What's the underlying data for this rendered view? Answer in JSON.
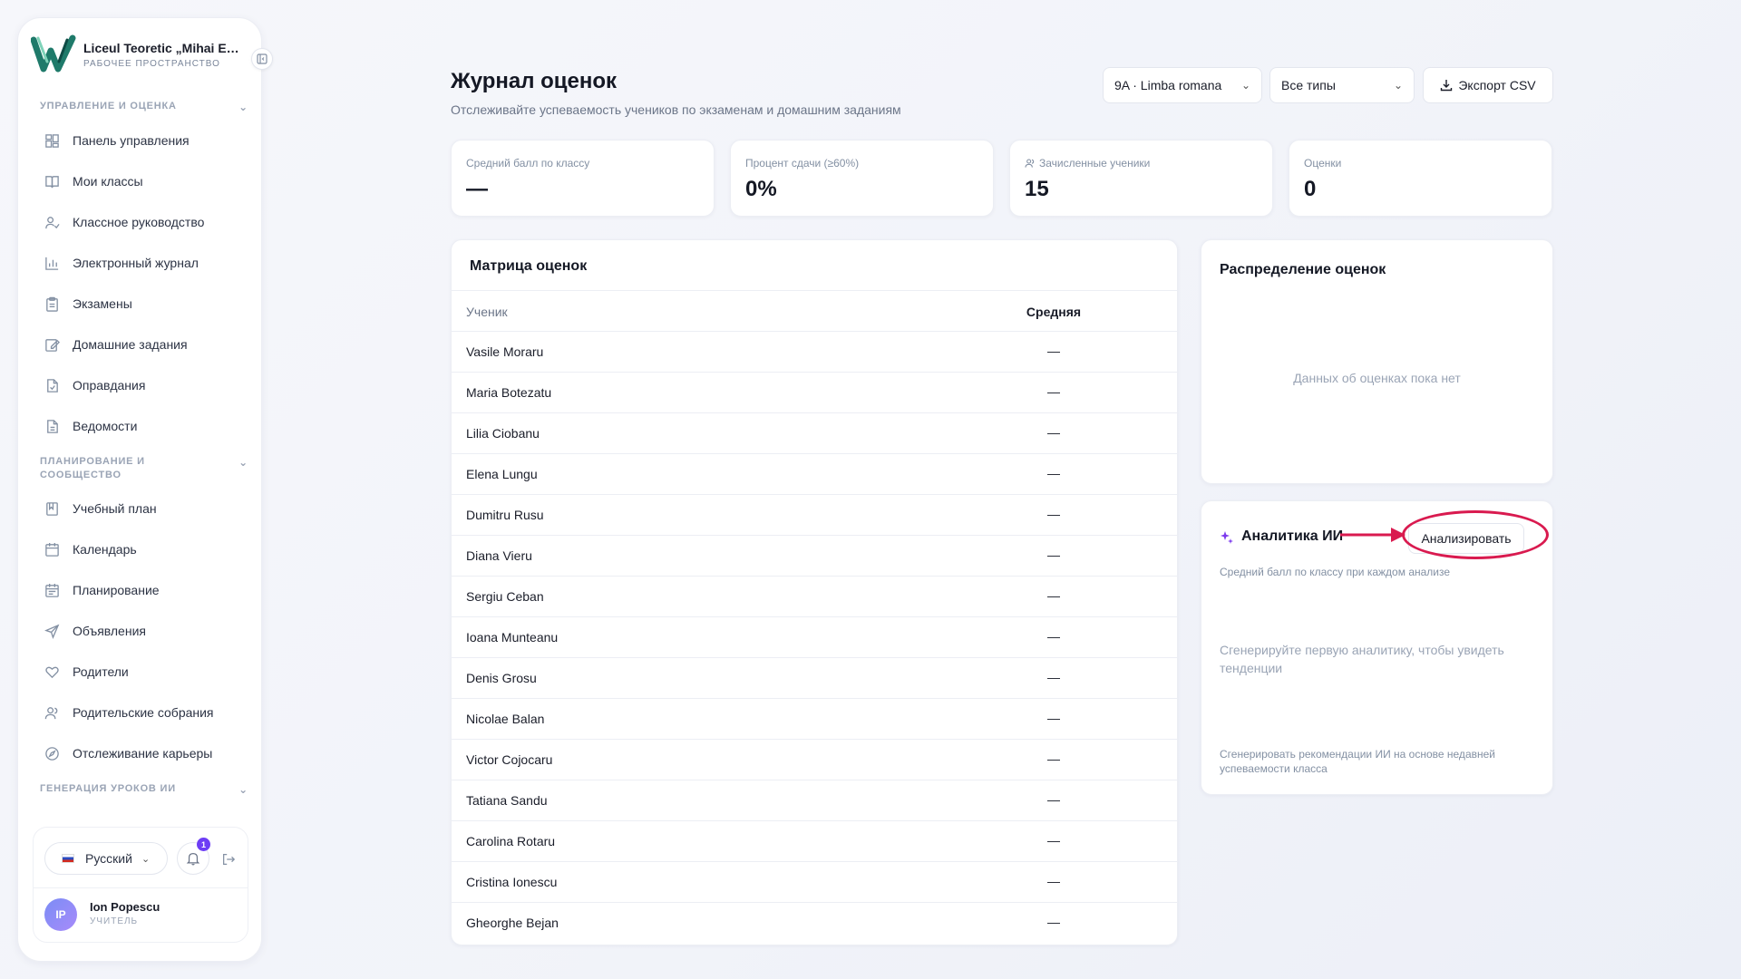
{
  "sidebar": {
    "brand_name": "Liceul Teoretic „Mihai Eminescu”",
    "brand_sub": "РАБОЧЕЕ ПРОСТРАНСТВО",
    "sections": {
      "manage": "УПРАВЛЕНИЕ И ОЦЕНКА",
      "plan": "ПЛАНИРОВАНИЕ И СООБЩЕСТВО",
      "ai": "ГЕНЕРАЦИЯ УРОКОВ ИИ"
    },
    "items": [
      {
        "label": "Панель управления",
        "icon": "dashboard-icon"
      },
      {
        "label": "Мои классы",
        "icon": "book-icon"
      },
      {
        "label": "Классное руководство",
        "icon": "user-check-icon"
      },
      {
        "label": "Электронный журнал",
        "icon": "bar-chart-icon"
      },
      {
        "label": "Экзамены",
        "icon": "clipboard-icon"
      },
      {
        "label": "Домашние задания",
        "icon": "edit-icon"
      },
      {
        "label": "Оправдания",
        "icon": "file-check-icon"
      },
      {
        "label": "Ведомости",
        "icon": "file-text-icon"
      },
      {
        "label": "Учебный план",
        "icon": "notebook-icon"
      },
      {
        "label": "Календарь",
        "icon": "calendar-icon"
      },
      {
        "label": "Планирование",
        "icon": "calendar-check-icon"
      },
      {
        "label": "Объявления",
        "icon": "send-icon"
      },
      {
        "label": "Родители",
        "icon": "heart-icon"
      },
      {
        "label": "Родительские собрания",
        "icon": "users-icon"
      },
      {
        "label": "Отслеживание карьеры",
        "icon": "compass-icon"
      }
    ],
    "footer": {
      "language": "Русский",
      "notifications_count": "1",
      "avatar_initials": "IP",
      "user_name": "Ion Popescu",
      "user_role": "УЧИТЕЛЬ"
    }
  },
  "header": {
    "title": "Журнал оценок",
    "subtitle": "Отслеживайте успеваемость учеников по экзаменам и домашним заданиям",
    "class_select": "9A · Limba romana",
    "type_select": "Все типы",
    "export_label": "Экспорт CSV"
  },
  "stats": [
    {
      "label": "Средний балл по классу",
      "value": "—"
    },
    {
      "label": "Процент сдачи (≥60%)",
      "value": "0%"
    },
    {
      "label": "Зачисленные ученики",
      "value": "15"
    },
    {
      "label": "Оценки",
      "value": "0"
    }
  ],
  "matrix": {
    "title": "Матрица оценок",
    "col_student": "Ученик",
    "col_average": "Средняя",
    "rows": [
      {
        "name": "Vasile Moraru",
        "avg": "—"
      },
      {
        "name": "Maria Botezatu",
        "avg": "—"
      },
      {
        "name": "Lilia Ciobanu",
        "avg": "—"
      },
      {
        "name": "Elena Lungu",
        "avg": "—"
      },
      {
        "name": "Dumitru Rusu",
        "avg": "—"
      },
      {
        "name": "Diana Vieru",
        "avg": "—"
      },
      {
        "name": "Sergiu Ceban",
        "avg": "—"
      },
      {
        "name": "Ioana Munteanu",
        "avg": "—"
      },
      {
        "name": "Denis Grosu",
        "avg": "—"
      },
      {
        "name": "Nicolae Balan",
        "avg": "—"
      },
      {
        "name": "Victor Cojocaru",
        "avg": "—"
      },
      {
        "name": "Tatiana Sandu",
        "avg": "—"
      },
      {
        "name": "Carolina Rotaru",
        "avg": "—"
      },
      {
        "name": "Cristina Ionescu",
        "avg": "—"
      },
      {
        "name": "Gheorghe Bejan",
        "avg": "—"
      }
    ]
  },
  "distribution": {
    "title": "Распределение оценок",
    "empty": "Данных об оценках пока нет"
  },
  "ai": {
    "title": "Аналитика ИИ",
    "analyze_label": "Анализировать",
    "subtitle": "Средний балл по классу при каждом анализе",
    "empty": "Сгенерируйте первую аналитику, чтобы увидеть тенденции",
    "footnote": "Сгенерировать рекомендации ИИ на основе недавней успеваемости класса"
  },
  "colors": {
    "accent": "#6d3df5",
    "highlight": "#d91a4f",
    "brand_green": "#1f7a6a"
  }
}
